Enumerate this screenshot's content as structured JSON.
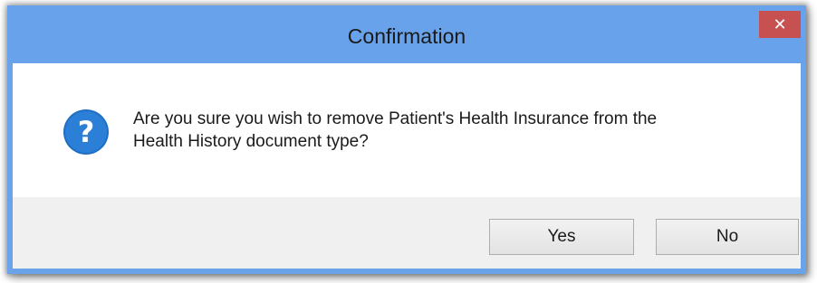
{
  "dialog": {
    "title": "Confirmation",
    "close_label": "✕",
    "icon": "question-icon",
    "message": "Are you sure you wish to remove Patient's Health Insurance from the\nHealth History document type?",
    "buttons": {
      "yes_label": "Yes",
      "no_label": "No"
    }
  },
  "colors": {
    "title_bar": "#68a2ea",
    "close_button": "#c75050",
    "icon_blue": "#1f6fc5",
    "footer": "#f0f0f0"
  }
}
